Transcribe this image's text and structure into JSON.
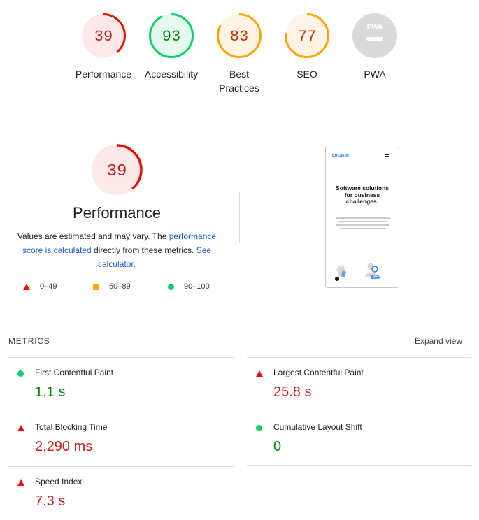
{
  "colors": {
    "fail": "#eb0f00",
    "fail_text": "#c7221f",
    "fail_bg": "#fde9e9",
    "average": "#ffa400",
    "average_text": "#c33300",
    "average_bg": "#fff4e5",
    "pass": "#0cce6b",
    "pass_text": "#008800",
    "pass_bg": "#e6f9ef",
    "na": "#dadada",
    "link": "#1a5bd6"
  },
  "gauges": [
    {
      "label": "Performance",
      "score": "39",
      "level": 0.39,
      "status": "fail"
    },
    {
      "label": "Accessibility",
      "score": "93",
      "level": 0.93,
      "status": "pass"
    },
    {
      "label": "Best Practices",
      "score": "83",
      "level": 0.83,
      "status": "average"
    },
    {
      "label": "SEO",
      "score": "77",
      "level": 0.77,
      "status": "average"
    },
    {
      "label": "PWA",
      "score": "PWA",
      "status": "na"
    }
  ],
  "performance": {
    "score": "39",
    "level": 0.39,
    "title": "Performance",
    "desc_prefix": "Values are estimated and may vary. The ",
    "desc_link1": "performance score is calculated",
    "desc_middle": " directly from these metrics. ",
    "desc_link2": "See calculator."
  },
  "legend": [
    {
      "icon": "fail-triangle-icon",
      "range": "0–49"
    },
    {
      "icon": "average-square-icon",
      "range": "50–89"
    },
    {
      "icon": "pass-circle-icon",
      "range": "90–100"
    }
  ],
  "screenshot": {
    "logo": "Locastic",
    "headline": "Software solutions for business challenges.",
    "icons": [
      "chess-knight-icon",
      "person-icon"
    ]
  },
  "metrics": {
    "header": "METRICS",
    "expand": "Expand view",
    "items": [
      {
        "title": "First Contentful Paint",
        "value": "1.1 s",
        "status": "pass"
      },
      {
        "title": "Largest Contentful Paint",
        "value": "25.8 s",
        "status": "fail"
      },
      {
        "title": "Total Blocking Time",
        "value": "2,290 ms",
        "status": "fail"
      },
      {
        "title": "Cumulative Layout Shift",
        "value": "0",
        "status": "pass"
      },
      {
        "title": "Speed Index",
        "value": "7.3 s",
        "status": "fail"
      }
    ]
  }
}
